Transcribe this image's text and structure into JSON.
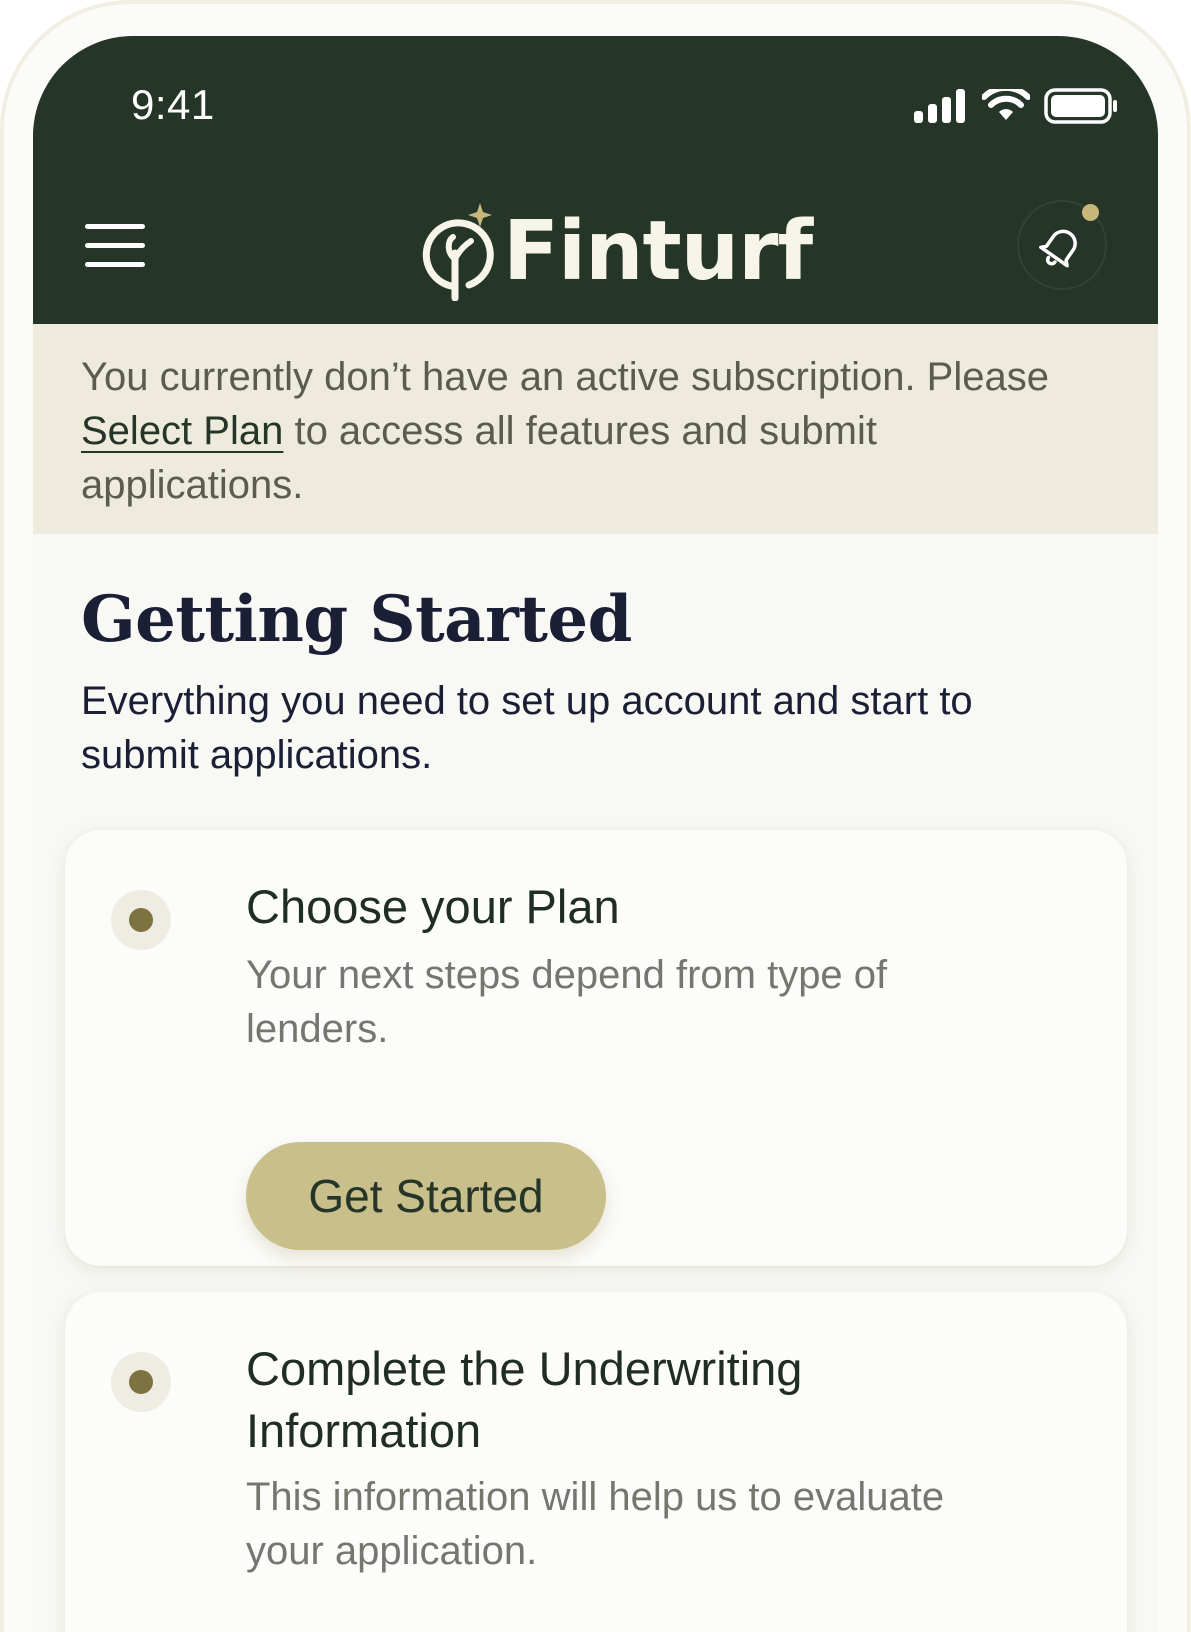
{
  "status_bar": {
    "time": "9:41"
  },
  "header": {
    "app_name": "Finturf",
    "menu_icon": "hamburger-menu-icon",
    "notification_icon": "bell-icon",
    "colors": {
      "header_bg": "#253528",
      "accent": "#c7b87a"
    }
  },
  "banner": {
    "text_before": "You currently don’t have an active subscription. Please ",
    "link": "Select Plan",
    "text_after": " to access all features and submit applications."
  },
  "main": {
    "title": "Getting Started",
    "subtitle": "Everything you need to set up account and start to submit applications."
  },
  "steps": [
    {
      "title": "Choose your Plan",
      "description": "Your next steps depend from type of lenders.",
      "button": "Get Started"
    },
    {
      "title": "Complete the Underwriting Information",
      "description": "This information will help us to evaluate your application."
    }
  ]
}
